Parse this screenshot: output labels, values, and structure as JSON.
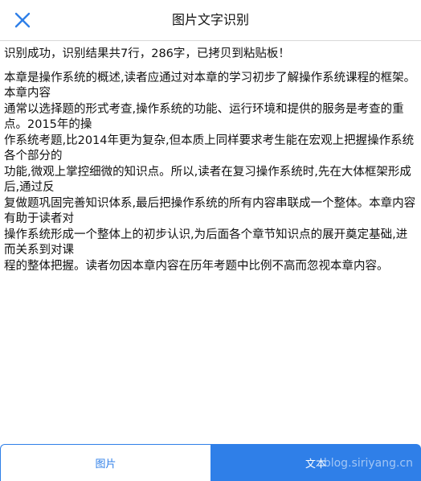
{
  "header": {
    "title": "图片文字识别",
    "close_icon": "close-icon",
    "accent_color": "#2f7fe8"
  },
  "result": {
    "status": "识别成功，识别结果共7行，286字，已拷贝到粘贴板！",
    "text": "本章是操作系统的概述,读者应通过对本章的学习初步了解操作系统课程的框架。本章内容\n通常以选择题的形式考查,操作系统的功能、运行环境和提供的服务是考查的重点。2015年的操\n作系统考题,比2014年更为复杂,但本质上同样要求考生能在宏观上把握操作系统各个部分的\n功能,微观上掌控细微的知识点。所以,读者在复习操作系统时,先在大体框架形成后,通过反\n复做题巩固完善知识体系,最后把操作系统的所有内容串联成一个整体。本章内容有助于读者对\n操作系统形成一个整体上的初步认识,为后面各个章节知识点的展开奠定基础,进而关系到对课\n程的整体把握。读者勿因本章内容在历年考题中比例不高而忽视本章内容。"
  },
  "tabs": [
    {
      "label": "图片",
      "active": false
    },
    {
      "label": "文本",
      "active": true
    }
  ],
  "watermark": "blog.siriyang.cn"
}
